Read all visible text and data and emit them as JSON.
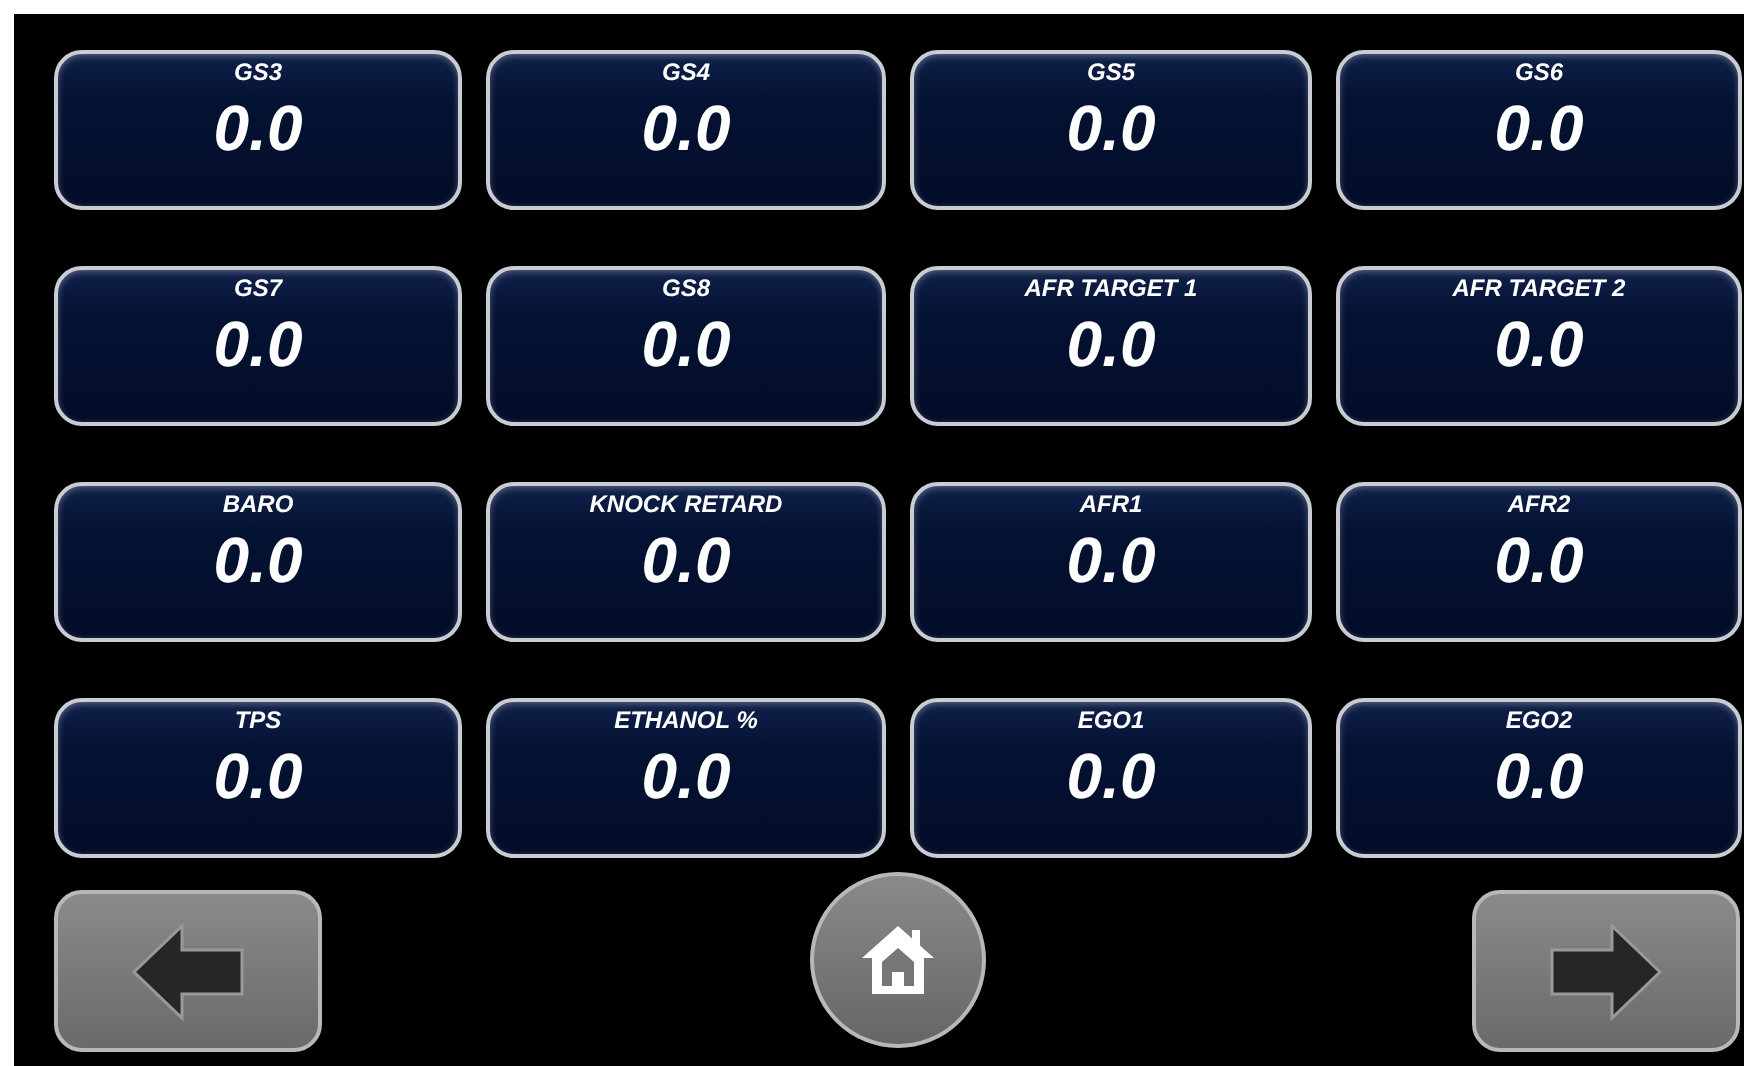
{
  "gauges": [
    {
      "label": "GS3",
      "value": "0.0"
    },
    {
      "label": "GS4",
      "value": "0.0"
    },
    {
      "label": "GS5",
      "value": "0.0"
    },
    {
      "label": "GS6",
      "value": "0.0"
    },
    {
      "label": "GS7",
      "value": "0.0"
    },
    {
      "label": "GS8",
      "value": "0.0"
    },
    {
      "label": "AFR TARGET 1",
      "value": "0.0"
    },
    {
      "label": "AFR TARGET 2",
      "value": "0.0"
    },
    {
      "label": "BARO",
      "value": "0.0"
    },
    {
      "label": "KNOCK RETARD",
      "value": "0.0"
    },
    {
      "label": "AFR1",
      "value": "0.0"
    },
    {
      "label": "AFR2",
      "value": "0.0"
    },
    {
      "label": "TPS",
      "value": "0.0"
    },
    {
      "label": "ETHANOL %",
      "value": "0.0"
    },
    {
      "label": "EGO1",
      "value": "0.0"
    },
    {
      "label": "EGO2",
      "value": "0.0"
    }
  ]
}
